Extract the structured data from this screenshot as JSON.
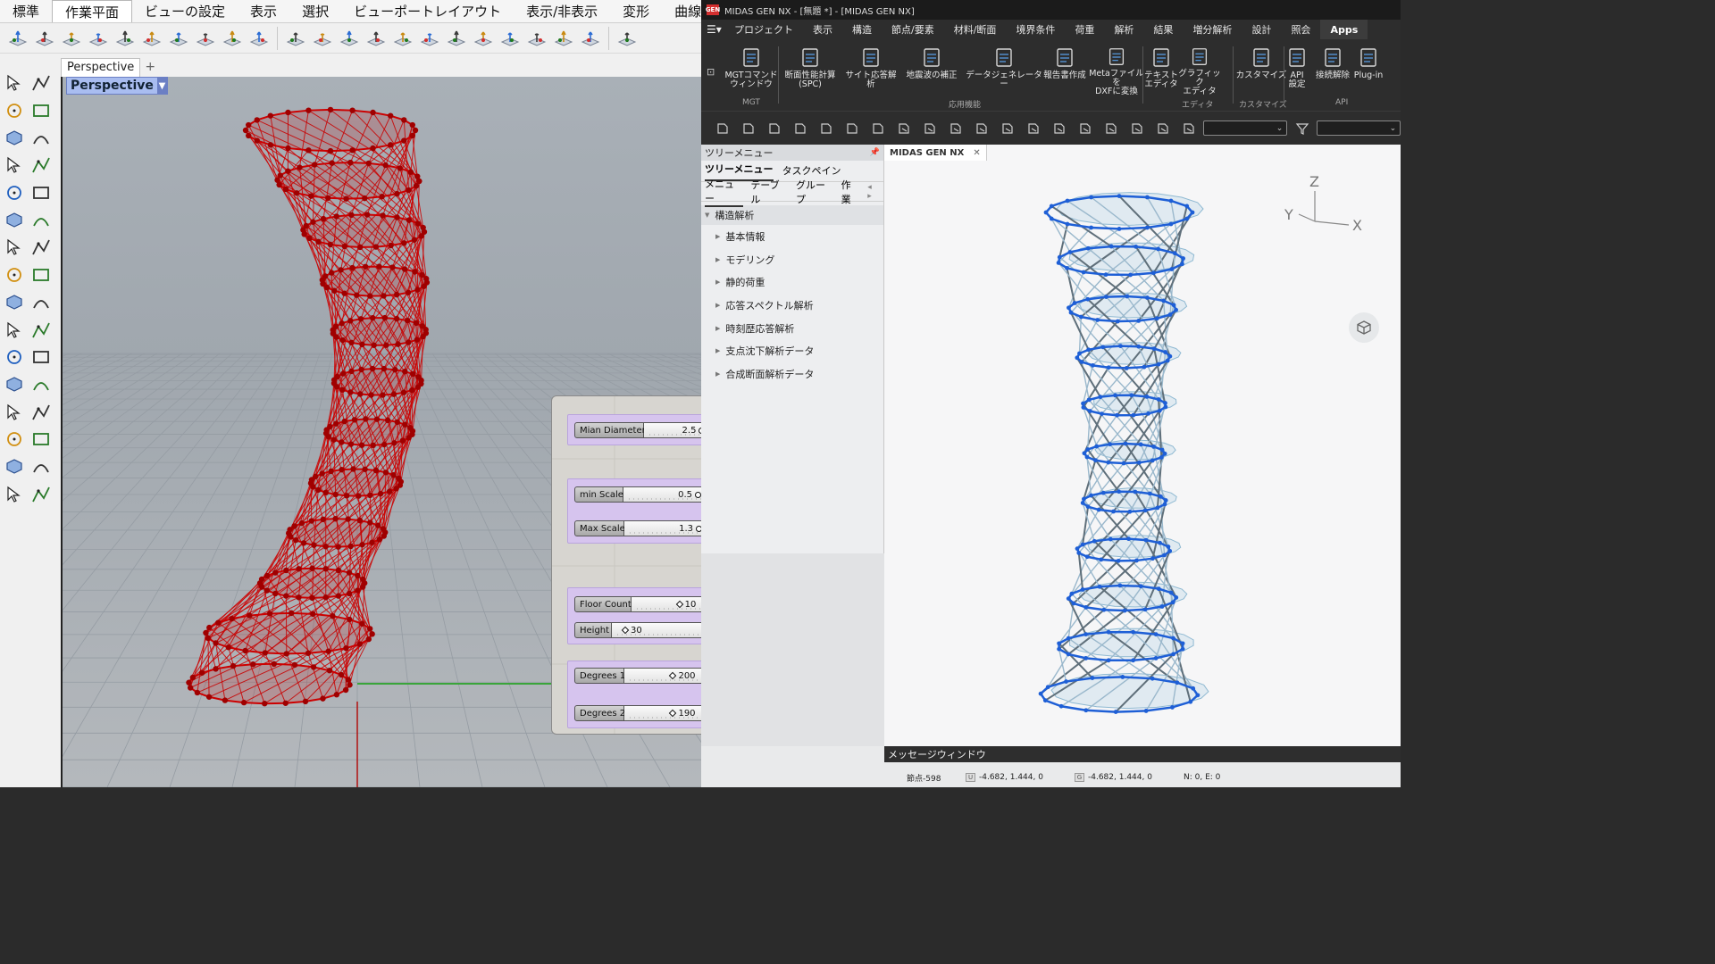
{
  "rhino": {
    "menu": [
      "標準",
      "作業平面",
      "ビューの設定",
      "表示",
      "選択",
      "ビューポートレイアウト",
      "表示/非表示",
      "変形",
      "曲線ツー"
    ],
    "active_menu": "作業平面",
    "viewport_tab": "Perspective",
    "viewport_label": "Perspective",
    "model_color": "#cc0000"
  },
  "grasshopper": {
    "sliders": [
      {
        "label": "Mian Diameter",
        "value": "2.5"
      },
      {
        "label": "min Scale",
        "value": "0.5"
      },
      {
        "label": "Max Scale",
        "value": "1.3"
      },
      {
        "label": "Floor Count",
        "value": "10"
      },
      {
        "label": "Height",
        "value": "30"
      },
      {
        "label": "Degrees 1",
        "value": "200"
      },
      {
        "label": "Degrees 2",
        "value": "190"
      }
    ],
    "group_color": "#d6c4ee"
  },
  "midas": {
    "title": "MIDAS GEN NX - [無題 *] - [MIDAS GEN NX]",
    "logo": "GEN",
    "menu": [
      "プロジェクト",
      "表示",
      "構造",
      "節点/要素",
      "材料/断面",
      "境界条件",
      "荷重",
      "解析",
      "結果",
      "増分解析",
      "設計",
      "照会",
      "Apps"
    ],
    "active_menu": "Apps",
    "ribbon": [
      {
        "label": "MGTコマンド\nウィンドウ",
        "icon": "command-window-icon"
      },
      {
        "label": "断面性能計算\n(SPC)",
        "icon": "section-property-icon"
      },
      {
        "label": "サイト応答解析",
        "icon": "site-response-icon"
      },
      {
        "label": "地震波の補正",
        "icon": "earthquake-wave-icon"
      },
      {
        "label": "データジェネレーター",
        "icon": "data-generator-icon"
      },
      {
        "label": "報告書作成",
        "icon": "report-icon"
      },
      {
        "label": "Metaファイルを\nDXFに変換",
        "icon": "dxf-convert-icon"
      },
      {
        "label": "テキスト\nエディタ",
        "icon": "text-editor-icon"
      },
      {
        "label": "グラフィック\nエディタ",
        "icon": "graphic-editor-icon"
      },
      {
        "label": "カスタマイズ",
        "icon": "customize-icon"
      },
      {
        "label": "API\n設定",
        "icon": "api-settings-icon"
      },
      {
        "label": "接続解除",
        "icon": "disconnect-icon"
      },
      {
        "label": "Plug-in",
        "icon": "plugin-icon"
      }
    ],
    "ribbon_groups": [
      "MGT",
      "応用機能",
      "エディタ",
      "カスタマイズ",
      "API"
    ],
    "tree": {
      "header": "ツリーメニュー",
      "tabs1": [
        "ツリーメニュー",
        "タスクペイン"
      ],
      "tabs2": [
        "メニュー",
        "テーブル",
        "グループ",
        "作業"
      ],
      "root": "構造解析",
      "items": [
        "基本情報",
        "モデリング",
        "静的荷重",
        "応答スペクトル解析",
        "時刻歴応答解析",
        "支点沈下解析データ",
        "合成断面解析データ"
      ]
    },
    "view_tab": "MIDAS GEN NX",
    "axis": {
      "z": "Z",
      "y": "Y",
      "x": "X"
    },
    "message_window": "メッセージウィンドウ",
    "status": {
      "node": "節点-598",
      "coord1": "-4.682, 1.444, 0",
      "coord2": "-4.682, 1.444, 0",
      "ne": "N: 0, E: 0"
    },
    "accent": "#1e5fd6"
  }
}
